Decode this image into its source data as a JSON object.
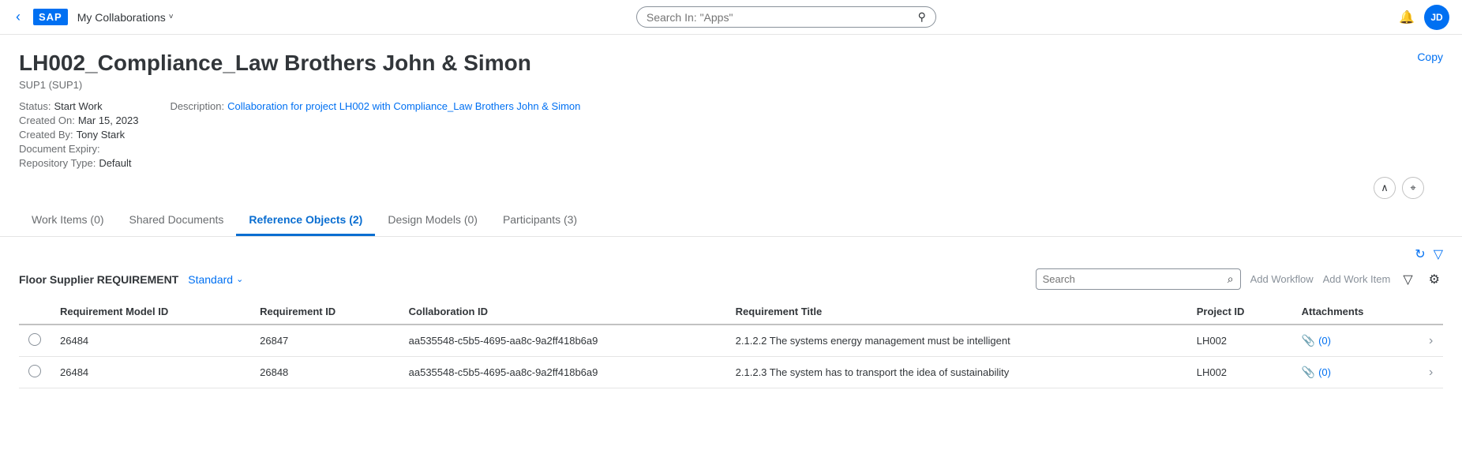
{
  "nav": {
    "back_label": "‹",
    "sap_label": "SAP",
    "app_title": "My Collaborations",
    "chevron": "˅",
    "search_placeholder": "Search In: \"Apps\"",
    "bell_icon": "🔔",
    "avatar_initials": "JD"
  },
  "page": {
    "title": "LH002_Compliance_Law Brothers John & Simon",
    "subtitle": "SUP1 (SUP1)",
    "copy_label": "Copy",
    "meta": {
      "status_label": "Status:",
      "status_value": "Start Work",
      "description_label": "Description:",
      "description_value": "Collaboration for project LH002 with Compliance_Law Brothers John & Simon",
      "created_on_label": "Created On:",
      "created_on_value": "Mar 15, 2023",
      "created_by_label": "Created By:",
      "created_by_value": "Tony Stark",
      "doc_expiry_label": "Document Expiry:",
      "doc_expiry_value": "",
      "repo_type_label": "Repository Type:",
      "repo_type_value": "Default"
    },
    "collapse_icon": "∧",
    "pin_icon": "⊕"
  },
  "tabs": [
    {
      "id": "work-items",
      "label": "Work Items (0)",
      "active": false
    },
    {
      "id": "shared-documents",
      "label": "Shared Documents",
      "active": false
    },
    {
      "id": "reference-objects",
      "label": "Reference Objects (2)",
      "active": true
    },
    {
      "id": "design-models",
      "label": "Design Models (0)",
      "active": false
    },
    {
      "id": "participants",
      "label": "Participants (3)",
      "active": false
    }
  ],
  "table_section": {
    "title": "Floor Supplier REQUIREMENT",
    "standard_label": "Standard",
    "search_placeholder": "Search",
    "add_workflow_label": "Add Workflow",
    "add_work_item_label": "Add Work Item",
    "refresh_icon": "↻",
    "filter_icon": "▽",
    "settings_icon": "⚙",
    "filter_icon2": "▽",
    "columns": [
      {
        "id": "radio",
        "label": ""
      },
      {
        "id": "req_model_id",
        "label": "Requirement Model ID"
      },
      {
        "id": "req_id",
        "label": "Requirement ID"
      },
      {
        "id": "collab_id",
        "label": "Collaboration ID"
      },
      {
        "id": "req_title",
        "label": "Requirement Title"
      },
      {
        "id": "project_id",
        "label": "Project ID"
      },
      {
        "id": "attachments",
        "label": "Attachments"
      },
      {
        "id": "nav",
        "label": ""
      }
    ],
    "rows": [
      {
        "req_model_id": "26484",
        "req_id": "26847",
        "collab_id": "aa535548-c5b5-4695-aa8c-9a2ff418b6a9",
        "req_title": "2.1.2.2 The systems energy management must be intelligent",
        "project_id": "LH002",
        "attachments": "(0)",
        "nav_arrow": "›"
      },
      {
        "req_model_id": "26484",
        "req_id": "26848",
        "collab_id": "aa535548-c5b5-4695-aa8c-9a2ff418b6a9",
        "req_title": "2.1.2.3 The system has to transport the idea of sustainability",
        "project_id": "LH002",
        "attachments": "(0)",
        "nav_arrow": "›"
      }
    ]
  }
}
